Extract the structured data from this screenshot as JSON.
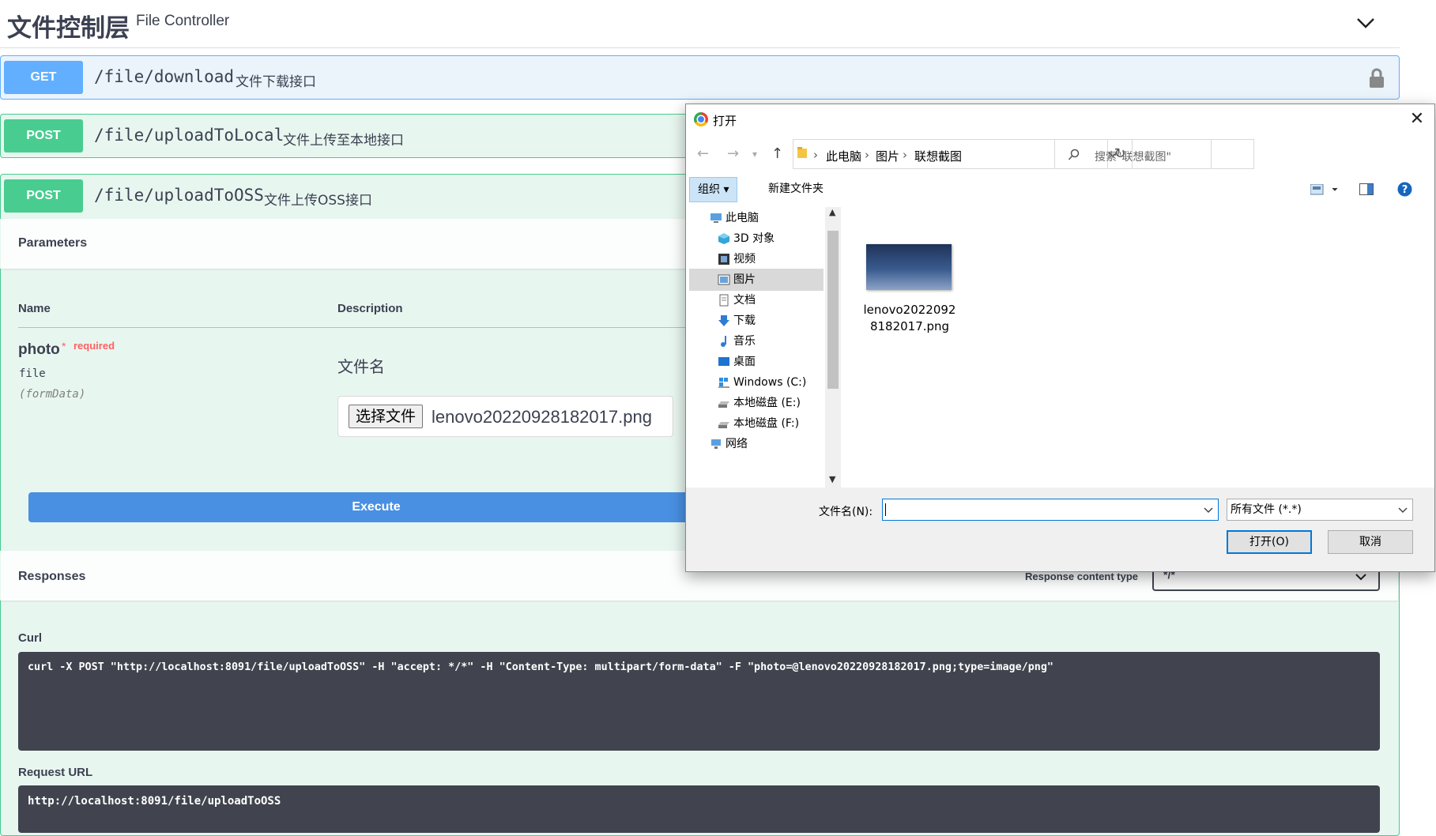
{
  "tag": {
    "title": "文件控制层",
    "description": "File Controller"
  },
  "ops": [
    {
      "method": "GET",
      "path": "/file/download",
      "summary": "文件下载接口"
    },
    {
      "method": "POST",
      "path": "/file/uploadToLocal",
      "summary": "文件上传至本地接口"
    },
    {
      "method": "POST",
      "path": "/file/uploadToOSS",
      "summary": "文件上传OSS接口"
    }
  ],
  "params": {
    "title": "Parameters",
    "col_name": "Name",
    "col_desc": "Description",
    "name": "photo",
    "required_star": "*",
    "required": "required",
    "type": "file",
    "in": "(formData)",
    "description": "文件名",
    "choose_file": "选择文件",
    "file_name": "lenovo20220928182017.png"
  },
  "execute_label": "Execute",
  "responses": {
    "title": "Responses",
    "content_type_label": "Response content type",
    "content_type_value": "*/*"
  },
  "curl": {
    "label": "Curl",
    "command": "curl -X POST \"http://localhost:8091/file/uploadToOSS\" -H \"accept: */*\" -H \"Content-Type: multipart/form-data\" -F \"photo=@lenovo20220928182017.png;type=image/png\""
  },
  "request_url": {
    "label": "Request URL",
    "value": "http://localhost:8091/file/uploadToOSS"
  },
  "dialog": {
    "title": "打开",
    "close": "✕",
    "breadcrumbs": [
      "此电脑",
      "图片",
      "联想截图"
    ],
    "search_placeholder": "搜索\"联想截图\"",
    "organize": "组织 ▾",
    "new_folder": "新建文件夹",
    "tree": [
      {
        "label": "此电脑",
        "icon": "computer-icon"
      },
      {
        "label": "3D 对象",
        "icon": "3d-objects-icon"
      },
      {
        "label": "视频",
        "icon": "video-icon"
      },
      {
        "label": "图片",
        "icon": "pictures-icon",
        "selected": true
      },
      {
        "label": "文档",
        "icon": "documents-icon"
      },
      {
        "label": "下载",
        "icon": "download-icon"
      },
      {
        "label": "音乐",
        "icon": "music-icon"
      },
      {
        "label": "桌面",
        "icon": "desktop-icon"
      },
      {
        "label": "Windows (C:)",
        "icon": "windows-drive-icon"
      },
      {
        "label": "本地磁盘 (E:)",
        "icon": "drive-icon"
      },
      {
        "label": "本地磁盘 (F:)",
        "icon": "drive-icon"
      },
      {
        "label": "网络",
        "icon": "network-icon"
      }
    ],
    "file": {
      "name_line1": "lenovo2022092",
      "name_line2": "8182017.png"
    },
    "filename_label": "文件名(N):",
    "filename_value": "",
    "filetype": "所有文件 (*.*)",
    "open": "打开(O)",
    "cancel": "取消"
  }
}
